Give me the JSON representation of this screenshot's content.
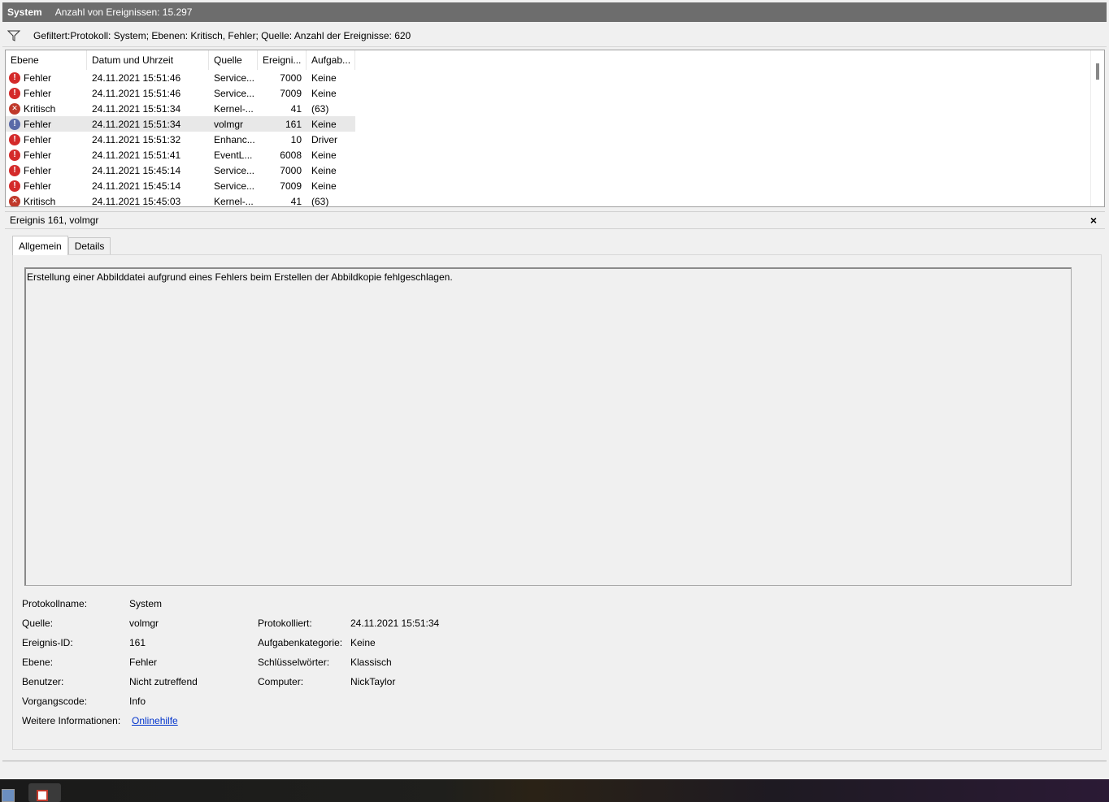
{
  "titlebar": {
    "name": "System",
    "count_text": "Anzahl von Ereignissen: 15.297"
  },
  "filter": {
    "text": "Gefiltert:Protokoll: System; Ebenen: Kritisch, Fehler; Quelle:  Anzahl der Ereignisse: 620"
  },
  "columns": [
    "Ebene",
    "Datum und Uhrzeit",
    "Quelle",
    "Ereigni...",
    "Aufgab..."
  ],
  "rows": [
    {
      "level": "Fehler",
      "icon": "error-icon",
      "date": "24.11.2021 15:51:46",
      "source": "Service...",
      "id": "7000",
      "task": "Keine"
    },
    {
      "level": "Fehler",
      "icon": "error-icon",
      "date": "24.11.2021 15:51:46",
      "source": "Service...",
      "id": "7009",
      "task": "Keine"
    },
    {
      "level": "Kritisch",
      "icon": "critical-icon",
      "date": "24.11.2021 15:51:34",
      "source": "Kernel-...",
      "id": "41",
      "task": "(63)"
    },
    {
      "level": "Fehler",
      "icon": "error-icon",
      "date": "24.11.2021 15:51:34",
      "source": "volmgr",
      "id": "161",
      "task": "Keine"
    },
    {
      "level": "Fehler",
      "icon": "error-icon",
      "date": "24.11.2021 15:51:32",
      "source": "Enhanc...",
      "id": "10",
      "task": "Driver"
    },
    {
      "level": "Fehler",
      "icon": "error-icon",
      "date": "24.11.2021 15:51:41",
      "source": "EventL...",
      "id": "6008",
      "task": "Keine"
    },
    {
      "level": "Fehler",
      "icon": "error-icon",
      "date": "24.11.2021 15:45:14",
      "source": "Service...",
      "id": "7000",
      "task": "Keine"
    },
    {
      "level": "Fehler",
      "icon": "error-icon",
      "date": "24.11.2021 15:45:14",
      "source": "Service...",
      "id": "7009",
      "task": "Keine"
    },
    {
      "level": "Kritisch",
      "icon": "critical-icon",
      "date": "24.11.2021 15:45:03",
      "source": "Kernel-...",
      "id": "41",
      "task": "(63)"
    }
  ],
  "selected_row": 3,
  "detail": {
    "title": "Ereignis 161, volmgr",
    "close": "×",
    "tabs": [
      "Allgemein",
      "Details"
    ],
    "message": "Erstellung einer Abbilddatei aufgrund eines Fehlers beim Erstellen der Abbildkopie fehlgeschlagen.",
    "props": {
      "log_name_label": "Protokollname:",
      "log_name": "System",
      "source_label": "Quelle:",
      "source": "volmgr",
      "logged_label": "Protokolliert:",
      "logged": "24.11.2021 15:51:34",
      "event_id_label": "Ereignis-ID:",
      "event_id": "161",
      "task_cat_label": "Aufgabenkategorie:",
      "task_cat": "Keine",
      "level_label": "Ebene:",
      "level": "Fehler",
      "keywords_label": "Schlüsselwörter:",
      "keywords": "Klassisch",
      "user_label": "Benutzer:",
      "user": "Nicht zutreffend",
      "computer_label": "Computer:",
      "computer": "NickTaylor",
      "opcode_label": "Vorgangscode:",
      "opcode": "Info",
      "more_info_label": "Weitere Informationen:",
      "more_info_link": "Onlinehilfe"
    }
  },
  "colors": {
    "titlebar": "#6d6d6d",
    "error": "#d42a2a",
    "link": "#0033cc"
  }
}
